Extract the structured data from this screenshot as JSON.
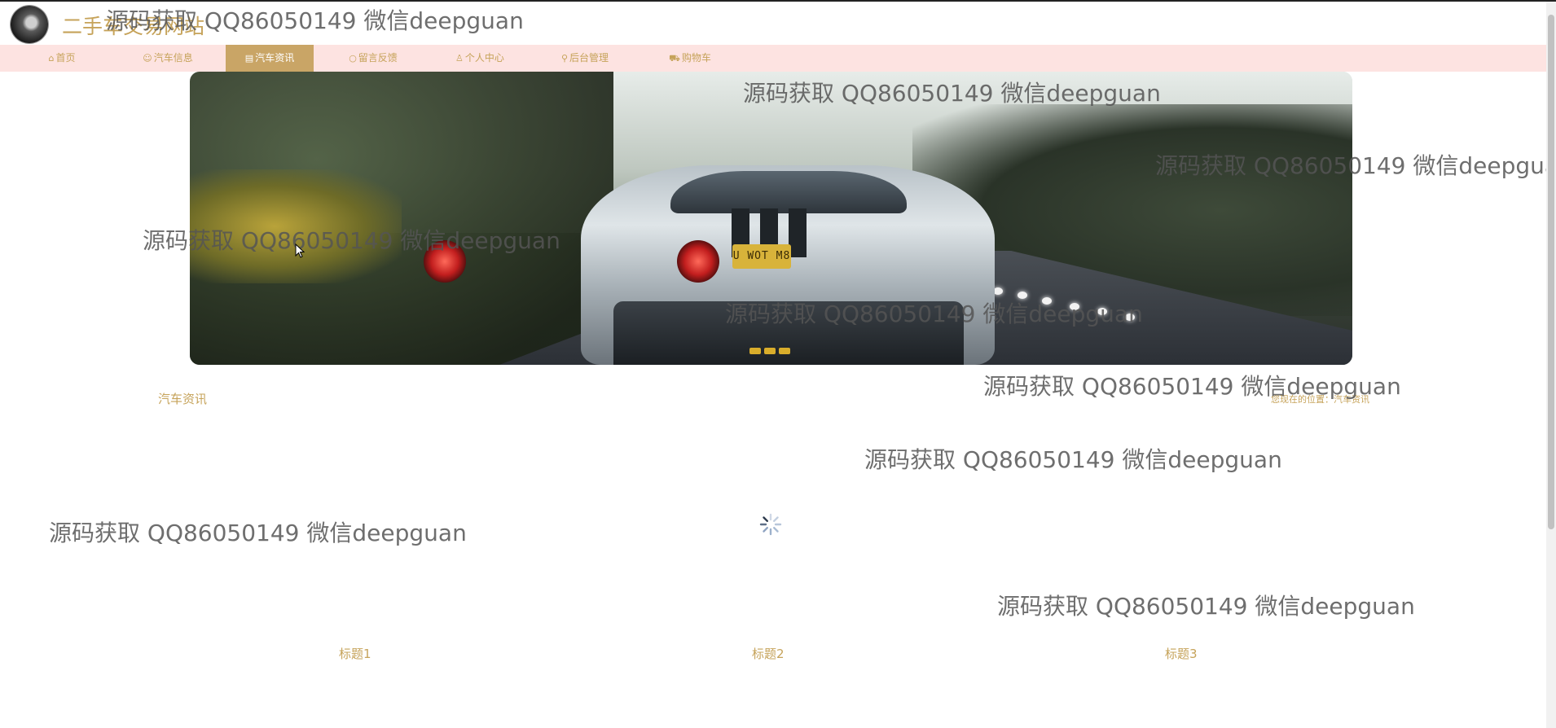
{
  "site": {
    "title": "二手车交易网站"
  },
  "nav": {
    "items": [
      {
        "icon": "⌂",
        "label": "首页"
      },
      {
        "icon": "☺",
        "label": "汽车信息"
      },
      {
        "icon": "▤",
        "label": "汽车资讯",
        "active": true
      },
      {
        "icon": "○",
        "label": "留言反馈"
      },
      {
        "icon": "♙",
        "label": "个人中心"
      },
      {
        "icon": "⚲",
        "label": "后台管理"
      },
      {
        "icon": "⛟",
        "label": "购物车"
      }
    ]
  },
  "banner": {
    "plate_text": "U WOT M8",
    "slides_total": 3
  },
  "section": {
    "title": "汽车资讯",
    "breadcrumb": "您现在的位置：汽车资讯"
  },
  "cards": {
    "titles": [
      "标题1",
      "标题2",
      "标题3"
    ]
  },
  "watermark": {
    "text": "源码获取 QQ86050149 微信deepguan"
  },
  "colors": {
    "accent": "#c6a35a",
    "nav_bg": "#fde3e1",
    "active_bg": "#c9a566",
    "dot": "#d9ad2b"
  }
}
